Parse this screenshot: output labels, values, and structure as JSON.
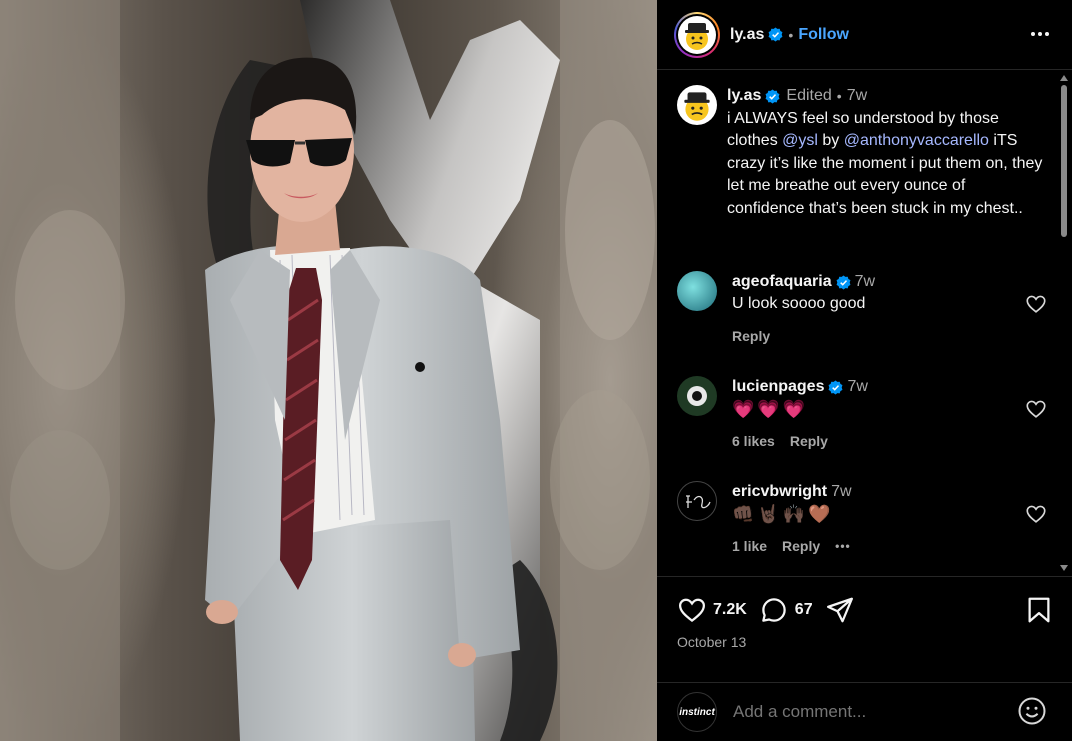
{
  "post": {
    "username": "ly.as",
    "follow_label": "Follow",
    "separator": "•"
  },
  "caption": {
    "username": "ly.as",
    "edited": "Edited",
    "separator": "•",
    "time": "7w",
    "text_1": "i ALWAYS feel so understood by those clothes ",
    "mention_1": "@ysl",
    "text_2": " by ",
    "mention_2": "@anthonyvaccarello",
    "text_3": " iTS crazy it’s like the moment i put them on, they let me breathe out every ounce of confidence that’s been stuck in my chest.."
  },
  "comments": [
    {
      "username": "ageofaquaria",
      "time": "7w",
      "text": "U look soooo good",
      "likes": "",
      "reply": "Reply"
    },
    {
      "username": "lucienpages",
      "time": "7w",
      "text": "💗💗💗",
      "likes": "6 likes",
      "reply": "Reply"
    },
    {
      "username": "ericvbwright",
      "time": "7w",
      "text": "👊🏿🤘🏿🙌🏿🤎",
      "likes": "1 like",
      "reply": "Reply",
      "more": "•••"
    }
  ],
  "stats": {
    "likes": "7.2K",
    "comments": "67",
    "date": "October 13"
  },
  "add_comment": {
    "placeholder": "Add a comment...",
    "avatar_text": "instinct"
  },
  "icons": {
    "more": "more-options-icon",
    "heart": "heart-icon",
    "comment": "comment-icon",
    "share": "share-icon",
    "bookmark": "bookmark-icon",
    "emoji": "emoji-icon",
    "verified": "verified-badge-icon"
  },
  "colors": {
    "background": "#000000",
    "link": "#4aa6ff",
    "mention": "#a6b8ff",
    "secondary_text": "#a8a8a8",
    "verified": "#0095f6",
    "divider": "#262626"
  }
}
